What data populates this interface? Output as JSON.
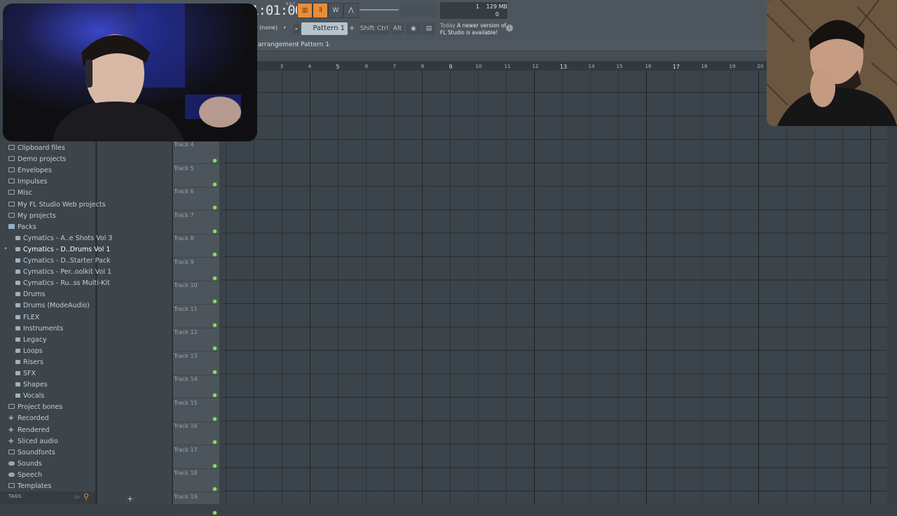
{
  "toolbar": {
    "time": "1:01:00",
    "time_sub": "B:S:T",
    "cpu": {
      "voices": "1",
      "memory": "129 MB",
      "polyphony": "0"
    },
    "snap": "(none)",
    "pattern": "Pattern 1",
    "keys": [
      "Shift",
      "Ctrl",
      "Alt"
    ],
    "news": {
      "date": "Today",
      "text": "A newer version of FL Studio is available!"
    }
  },
  "breadcrumb": {
    "first": "arrangement",
    "second": "Pattern 1"
  },
  "ruler": {
    "major": [
      "5",
      "9",
      "13",
      "17"
    ],
    "minor": [
      "3",
      "4",
      "6",
      "7",
      "8",
      "10",
      "11",
      "12",
      "14",
      "15",
      "16",
      "18",
      "19",
      "20"
    ]
  },
  "browser": {
    "items": [
      "Clipboard files",
      "Demo projects",
      "Envelopes",
      "Impulses",
      "Misc",
      "My FL Studio Web projects",
      "My projects",
      "Packs",
      "Cymatics - A..e Shots Vol 3",
      "Cymatics - D..Drums Vol 1",
      "Cymatics - D..Starter Pack",
      "Cymatics - Per..oolkit Vol 1",
      "Cymatics - Ru..ss Multi-Kit",
      "Drums",
      "Drums (ModeAudio)",
      "FLEX",
      "Instruments",
      "Legacy",
      "Loops",
      "Risers",
      "SFX",
      "Shapes",
      "Vocals",
      "Project bones",
      "Recorded",
      "Rendered",
      "Sliced audio",
      "Soundfonts",
      "Sounds",
      "Speech",
      "Templates"
    ],
    "tags_label": "TAGS"
  },
  "tracks": [
    "Track 4",
    "Track 5",
    "Track 6",
    "Track 7",
    "Track 8",
    "Track 9",
    "Track 10",
    "Track 11",
    "Track 12",
    "Track 13",
    "Track 14",
    "Track 15",
    "Track 16",
    "Track 17",
    "Track 18",
    "Track 19"
  ],
  "colors": {
    "accent": "#e98d3a",
    "track_led": "#8fe05f",
    "grid": "#3b444b"
  }
}
